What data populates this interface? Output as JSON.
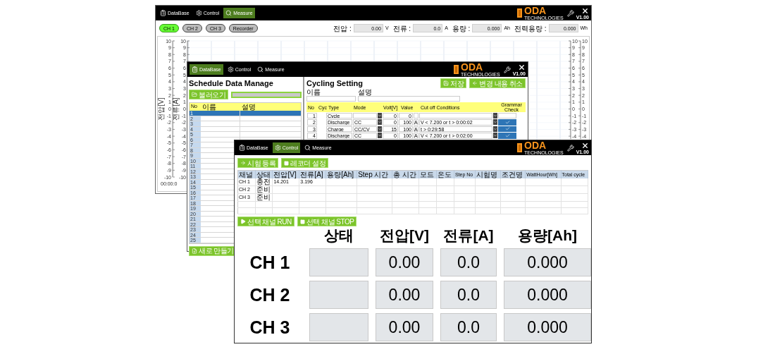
{
  "measure_window": {
    "tabs": [
      {
        "label": "DataBase",
        "selected": false
      },
      {
        "label": "Control",
        "selected": false
      },
      {
        "label": "Measure",
        "selected": true
      }
    ],
    "logo": {
      "name": "ODA",
      "subtitle": "TECHNOLOGIES",
      "version": "V1.00"
    },
    "channels": [
      {
        "label": "CH 1",
        "selected": true
      },
      {
        "label": "CH 2",
        "selected": false
      },
      {
        "label": "CH 3",
        "selected": false
      },
      {
        "label": "Recorder",
        "selected": false
      }
    ],
    "readouts": [
      {
        "label": "전압 :",
        "value": "0.00",
        "unit": "V"
      },
      {
        "label": "전류 :",
        "value": "0.0",
        "unit": "A"
      },
      {
        "label": "용량 :",
        "value": "0.000",
        "unit": "Ah"
      },
      {
        "label": "전력용량 :",
        "value": "0.000",
        "unit": "Wh"
      }
    ],
    "chart": {
      "left_axes": [
        {
          "title": "전압[V]",
          "ticks": [
            "10",
            "9",
            "8",
            "7",
            "6",
            "5",
            "4",
            "3",
            "2",
            "1",
            "0",
            "-1",
            "-2",
            "-3",
            "-4",
            "-5",
            "-6",
            "-7",
            "-8",
            "-9",
            "-10"
          ]
        },
        {
          "title": "전류[A]",
          "ticks": [
            "10",
            "9",
            "8",
            "7",
            "6",
            "5",
            "4",
            "3",
            "2",
            "1",
            "0",
            "-1",
            "-2",
            "-3",
            "-4",
            "-5",
            "-6",
            "-7",
            "-8",
            "-9",
            "-10"
          ]
        }
      ],
      "right_axes": [
        {
          "ticks": [
            "10",
            "9",
            "8",
            "7",
            "6",
            "5",
            "4",
            "3",
            "2",
            "1",
            "0",
            "-1",
            "-2",
            "-3",
            "-4"
          ]
        },
        {
          "ticks": [
            "10",
            "9",
            "8",
            "7",
            "6",
            "5",
            "4",
            "3",
            "2",
            "1",
            "0",
            "-1",
            "-2",
            "-3",
            "-4"
          ]
        }
      ],
      "time_label": "00:00:0"
    }
  },
  "database_window": {
    "tabs": [
      {
        "label": "DataBase",
        "selected": true
      },
      {
        "label": "Control",
        "selected": false
      },
      {
        "label": "Measure",
        "selected": false
      }
    ],
    "logo": {
      "name": "ODA",
      "subtitle": "TECHNOLOGIES",
      "version": "V1.00"
    },
    "schedule": {
      "title": "Schedule Data Manage",
      "load_button": "불러오기",
      "columns": [
        "No",
        "이름",
        "설명"
      ],
      "rows": [
        {
          "no": "1",
          "selected": true
        },
        {
          "no": "2",
          "selected": false
        },
        {
          "no": "3",
          "selected": false
        },
        {
          "no": "4",
          "selected": false
        },
        {
          "no": "5",
          "selected": false
        },
        {
          "no": "6",
          "selected": false
        },
        {
          "no": "7",
          "selected": false
        },
        {
          "no": "8",
          "selected": false
        },
        {
          "no": "9",
          "selected": false
        },
        {
          "no": "10",
          "selected": false
        },
        {
          "no": "11",
          "selected": false
        },
        {
          "no": "12",
          "selected": false
        },
        {
          "no": "13",
          "selected": false
        },
        {
          "no": "14",
          "selected": false
        },
        {
          "no": "15",
          "selected": false
        },
        {
          "no": "16",
          "selected": false
        },
        {
          "no": "17",
          "selected": false
        },
        {
          "no": "18",
          "selected": false
        },
        {
          "no": "19",
          "selected": false
        },
        {
          "no": "20",
          "selected": false
        },
        {
          "no": "21",
          "selected": false
        },
        {
          "no": "22",
          "selected": false
        },
        {
          "no": "23",
          "selected": false
        },
        {
          "no": "24",
          "selected": false
        },
        {
          "no": "25",
          "selected": false
        }
      ],
      "new_button": "새로 만들기"
    },
    "cycling": {
      "title": "Cycling Setting",
      "save_button": "저장",
      "cancel_button": "변경 내용 취소",
      "fields": [
        {
          "label": "이름"
        },
        {
          "label": "설명"
        }
      ],
      "columns": {
        "no": "No",
        "cyc": "Cyc",
        "type": "Type",
        "mode": "Mode",
        "volt": "Volt[V]",
        "value": "Value",
        "conditions": "Cut off Conditions",
        "check": "Grammar Check"
      },
      "rows": [
        {
          "no": "1",
          "type": "Cycle",
          "mode": "",
          "volt": "0",
          "value": "0",
          "unit": "",
          "condition": "",
          "checked": false
        },
        {
          "no": "2",
          "type": "Discharge",
          "mode": "CC",
          "volt": "0",
          "value": "100",
          "unit": "A",
          "condition": "V < 7.200 or t > 0:00:02",
          "checked": true
        },
        {
          "no": "3",
          "type": "Charge",
          "mode": "CC/CV",
          "volt": "15",
          "value": "100",
          "unit": "A",
          "condition": "t > 0:29:58",
          "checked": true
        },
        {
          "no": "4",
          "type": "Discharge",
          "mode": "CC",
          "volt": "0",
          "value": "100",
          "unit": "A",
          "condition": "V < 7.200 or t > 0:02:00",
          "checked": true
        }
      ]
    }
  },
  "control_window": {
    "tabs": [
      {
        "label": "DataBase",
        "selected": false
      },
      {
        "label": "Control",
        "selected": true
      },
      {
        "label": "Measure",
        "selected": false
      }
    ],
    "logo": {
      "name": "ODA",
      "subtitle": "TECHNOLOGIES",
      "version": "V1.00"
    },
    "top_buttons": [
      "시험 등록",
      "레코더 설정"
    ],
    "table": {
      "columns": [
        "채널",
        "상태",
        "전압[V]",
        "전류[A]",
        "용량[Ah]",
        "Step 시간",
        "총 시간",
        "모드",
        "온도",
        "Step No",
        "시험명",
        "조건명",
        "WattHour[Wh]",
        "Total cycle"
      ],
      "rows": [
        [
          "CH 1",
          "충전",
          "14.201",
          "3.196"
        ],
        [
          "CH 2",
          "준비"
        ],
        [
          "CH 3",
          "준비"
        ]
      ]
    },
    "run_button": "선택 채널 RUN",
    "stop_button": "선택 채널 STOP",
    "display": {
      "headers": [
        "상태",
        "전압[V]",
        "전류[A]",
        "용량[Ah]"
      ],
      "rows": [
        {
          "label": "CH 1",
          "voltage": "0.00",
          "current": "0.0",
          "capacity": "0.000"
        },
        {
          "label": "CH 2",
          "voltage": "0.00",
          "current": "0.0",
          "capacity": "0.000"
        },
        {
          "label": "CH 3",
          "voltage": "0.00",
          "current": "0.0",
          "capacity": "0.000"
        }
      ]
    }
  }
}
